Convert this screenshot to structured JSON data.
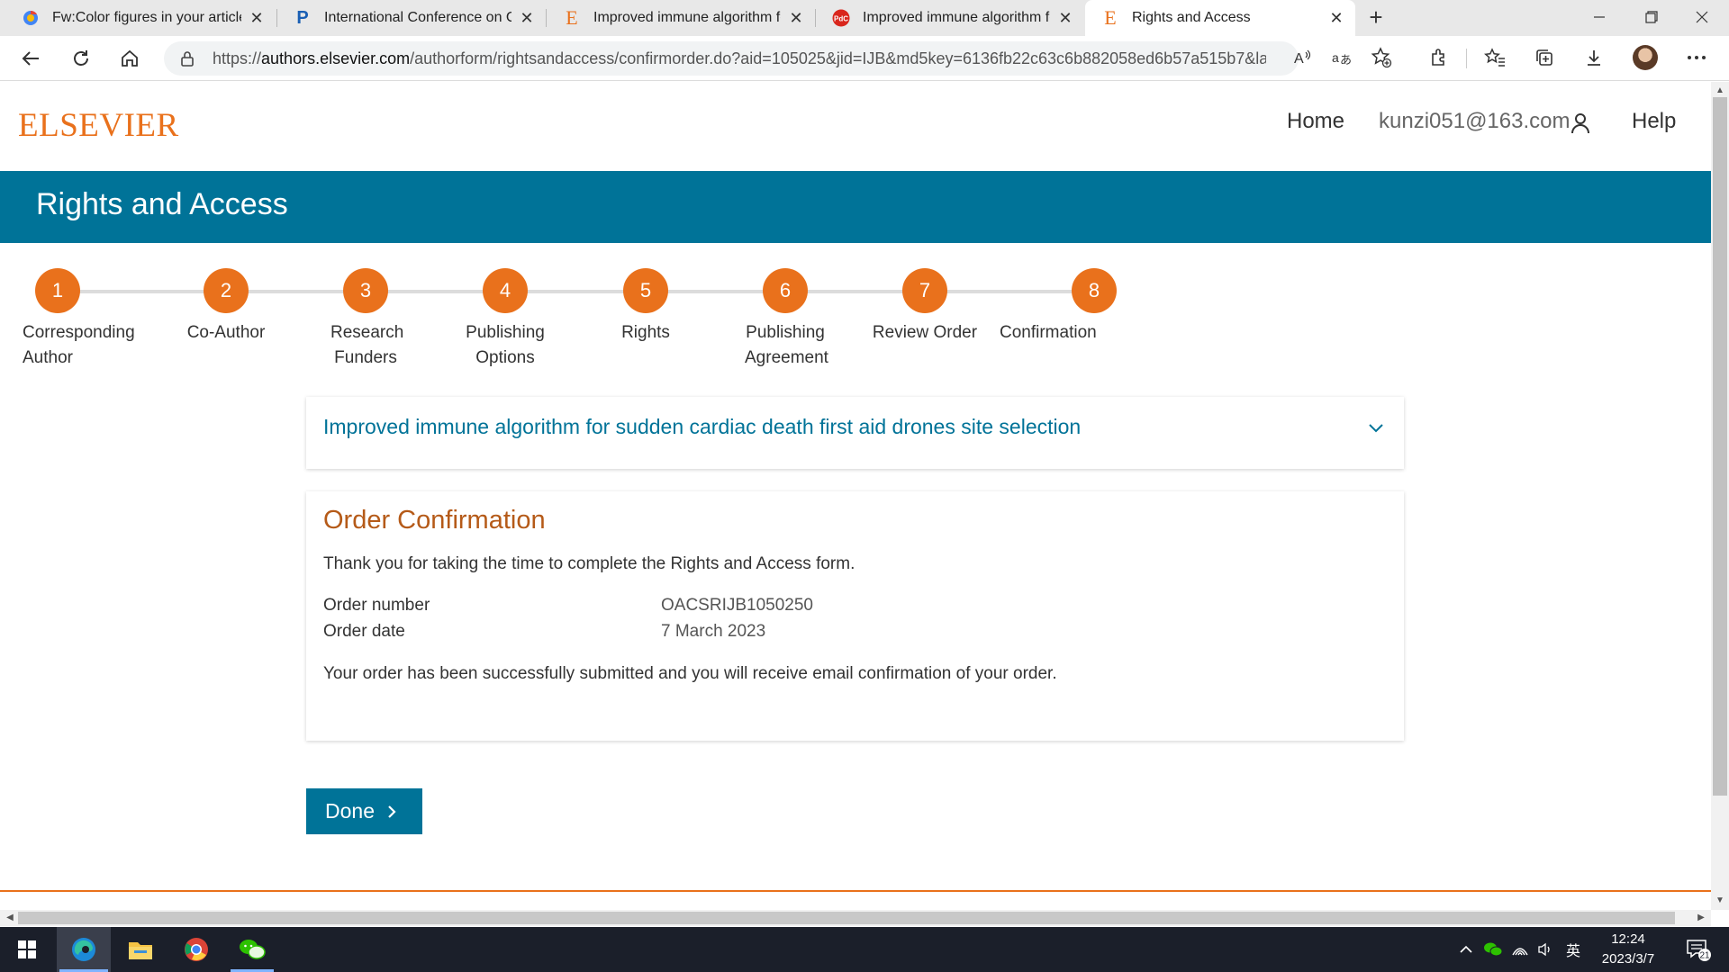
{
  "browser": {
    "tabs": [
      {
        "title": "Fw:Color figures in your article [U",
        "icon": "mail-icon"
      },
      {
        "title": "International Conference on Card",
        "icon": "p-logo-icon"
      },
      {
        "title": "Improved immune algorithm for",
        "icon": "elsevier-e-icon"
      },
      {
        "title": "Improved immune algorithm for",
        "icon": "pdf-icon"
      },
      {
        "title": "Rights and Access",
        "icon": "elsevier-e-icon"
      }
    ],
    "url_prefix": "https://",
    "url_host": "authors.elsevier.com",
    "url_path": "/authorform/rightsandaccess/confirmorder.do?aid=105025&jid=IJB&md5key=6136fb22c63c6b882058ed6b57a515b7&lan..."
  },
  "site": {
    "logo": "ELSEVIER",
    "nav": {
      "home": "Home",
      "user": "kunzi051@163.com",
      "help": "Help"
    }
  },
  "banner": {
    "title": "Rights and Access"
  },
  "steps": [
    {
      "num": "1",
      "label": "Corresponding Author"
    },
    {
      "num": "2",
      "label": "Co-Author"
    },
    {
      "num": "3",
      "label": "Research Funders"
    },
    {
      "num": "4",
      "label": "Publishing Options"
    },
    {
      "num": "5",
      "label": "Rights"
    },
    {
      "num": "6",
      "label": "Publishing Agreement"
    },
    {
      "num": "7",
      "label": "Review Order"
    },
    {
      "num": "8",
      "label": "Confirmation"
    }
  ],
  "article": {
    "title": "Improved immune algorithm for sudden cardiac death first aid drones site selection"
  },
  "order": {
    "heading": "Order Confirmation",
    "thanks": "Thank you for taking the time to complete the Rights and Access form.",
    "number_label": "Order number",
    "number_value": "OACSRIJB1050250",
    "date_label": "Order date",
    "date_value": "7 March 2023",
    "submitted": "Your order has been successfully submitted and you will receive email confirmation of your order."
  },
  "done_label": "Done",
  "taskbar": {
    "time": "12:24",
    "date": "2023/3/7",
    "ime": "英",
    "notifications": "21"
  },
  "colors": {
    "accent_orange": "#e9711c",
    "banner_blue": "#007398",
    "heading_brown": "#b55a18"
  }
}
